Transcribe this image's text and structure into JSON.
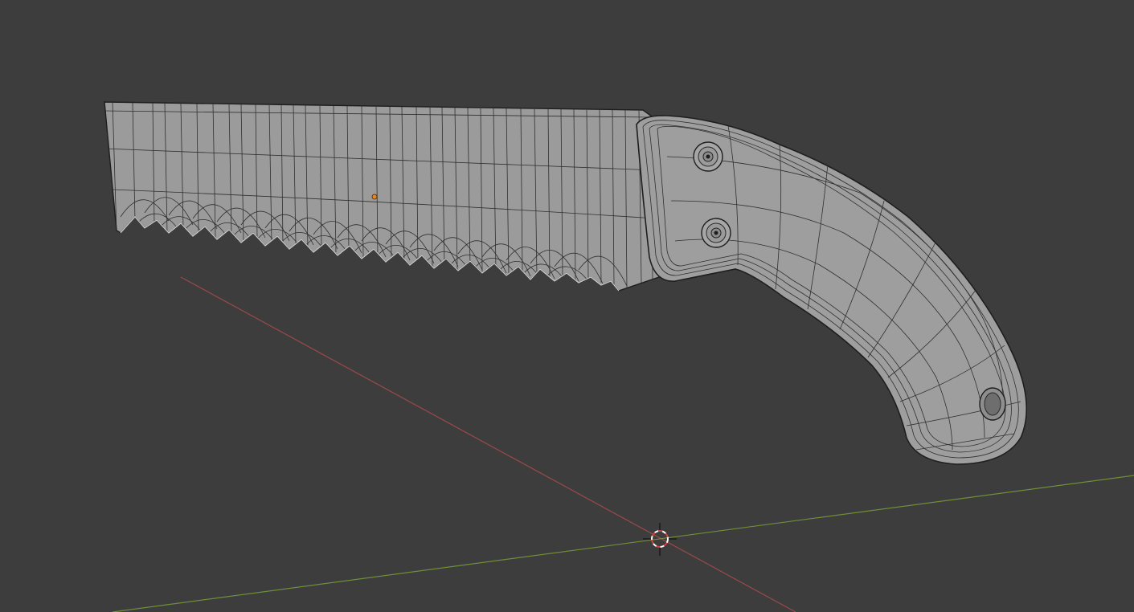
{
  "viewport": {
    "mode": "3d-viewport",
    "background": "#3d3d3d"
  },
  "axes": {
    "x_axis_color": "#9a4a4a",
    "y_axis_color": "#6f8f3a"
  },
  "object": {
    "type": "hand-saw-mesh",
    "display": "wireframe-overlay",
    "surface_color": "#9a9a9a",
    "wire_color": "#2a2a2a",
    "origin_color": "#e8891e"
  },
  "cursor": {
    "type": "3d-cursor",
    "color_a": "#ffffff",
    "color_b": "#d04040"
  }
}
